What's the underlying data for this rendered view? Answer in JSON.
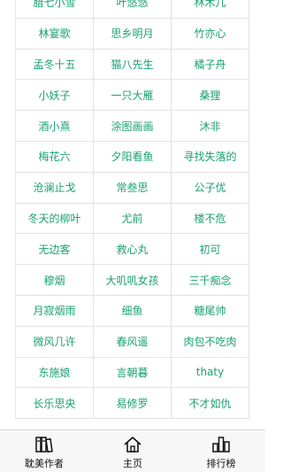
{
  "authors": [
    [
      "腊七小雪",
      "叶悠悠",
      "林木儿"
    ],
    [
      "林宴歌",
      "思乡明月",
      "竹亦心"
    ],
    [
      "孟冬十五",
      "猫八先生",
      "橘子舟"
    ],
    [
      "小妖子",
      "一只大雁",
      "桑狸"
    ],
    [
      "酒小熹",
      "涂图画画",
      "沐非"
    ],
    [
      "梅花六",
      "夕阳看鱼",
      "寻找失落的"
    ],
    [
      "沧澜止戈",
      "常叁思",
      "公子优"
    ],
    [
      "冬天的柳叶",
      "尤前",
      "楼不危"
    ],
    [
      "无边客",
      "救心丸",
      "初可"
    ],
    [
      "穆烟",
      "大叽叽女孩",
      "三千痴念"
    ],
    [
      "月寂烟雨",
      "细鱼",
      "糖尾帅"
    ],
    [
      "微风几许",
      "春风遥",
      "肉包不吃肉"
    ],
    [
      "东施娘",
      "言朝暮",
      "thaty"
    ],
    [
      "长乐思央",
      "易修罗",
      "不才如仇"
    ]
  ],
  "colors": {
    "author_text": "#1aa16e",
    "grid_line": "#e3e3e3",
    "tabbar_bg": "#f7f7f7"
  },
  "tabbar": {
    "tabs": [
      {
        "label": "耽美作者",
        "icon": "books-icon"
      },
      {
        "label": "主页",
        "icon": "home-icon"
      },
      {
        "label": "排行榜",
        "icon": "ranking-icon"
      }
    ]
  }
}
